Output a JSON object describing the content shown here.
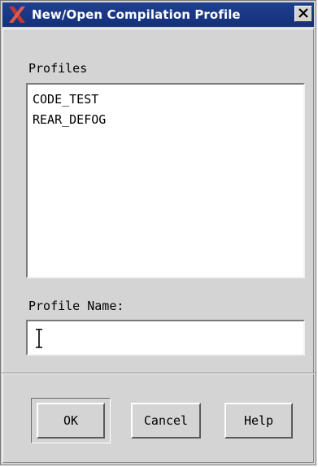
{
  "window": {
    "title": "New/Open Compilation Profile",
    "close_symbol": "X"
  },
  "profiles": {
    "label": "Profiles",
    "items": [
      "CODE_TEST",
      "REAR_DEFOG"
    ]
  },
  "profile_name": {
    "label": "Profile Name:",
    "value": ""
  },
  "buttons": {
    "ok": "OK",
    "cancel": "Cancel",
    "help": "Help"
  },
  "colors": {
    "titlebar": "#1f3f8f",
    "dialog_bg": "#d4d4d4",
    "x_logo": "#c0392b"
  },
  "icons": {
    "title": "x-window-logo-icon",
    "close": "close-icon",
    "cursor": "text-cursor-icon"
  }
}
